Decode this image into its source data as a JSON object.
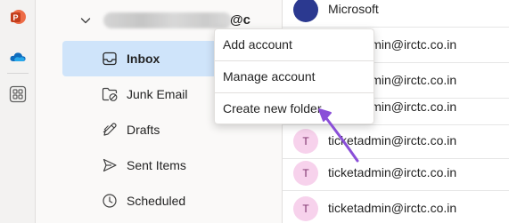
{
  "rail": {
    "apps": [
      {
        "icon": "powerpoint-icon",
        "letter": "P"
      },
      {
        "icon": "onedrive-icon"
      },
      {
        "icon": "apps-grid-icon"
      }
    ]
  },
  "account": {
    "name_visible_suffix": "@c"
  },
  "folders": [
    {
      "label": "Inbox",
      "icon": "inbox-icon",
      "active": true
    },
    {
      "label": "Junk Email",
      "icon": "junk-folder-icon",
      "active": false
    },
    {
      "label": "Drafts",
      "icon": "drafts-pencil-icon",
      "active": false
    },
    {
      "label": "Sent Items",
      "icon": "send-icon",
      "active": false
    },
    {
      "label": "Scheduled",
      "icon": "clock-icon",
      "active": false
    }
  ],
  "messages": [
    {
      "sender": "Microsoft",
      "avatar_initial": "",
      "avatar_color": "#2b3990"
    },
    {
      "sender": "ticketadmin@irctc.co.in",
      "avatar_initial": "T",
      "avatar_color": "#f7d2ec"
    },
    {
      "sender": "ticketadmin@irctc.co.in",
      "avatar_initial": "T",
      "avatar_color": "#f7d2ec"
    },
    {
      "sender": "ticketadmin@irctc.co.in",
      "avatar_initial": "T",
      "avatar_color": "#f7d2ec"
    },
    {
      "sender": "ticketadmin@irctc.co.in",
      "avatar_initial": "T",
      "avatar_color": "#f7d2ec"
    },
    {
      "sender": "ticketadmin@irctc.co.in",
      "avatar_initial": "T",
      "avatar_color": "#f7d2ec"
    },
    {
      "sender": "ticketadmin@irctc.co.in",
      "avatar_initial": "T",
      "avatar_color": "#f7d2ec"
    }
  ],
  "context_menu": {
    "items": [
      "Add account",
      "Manage account",
      "Create new folder"
    ]
  },
  "colors": {
    "accent_selected": "#cfe4fa",
    "annotation_arrow": "#8a4fd8"
  }
}
